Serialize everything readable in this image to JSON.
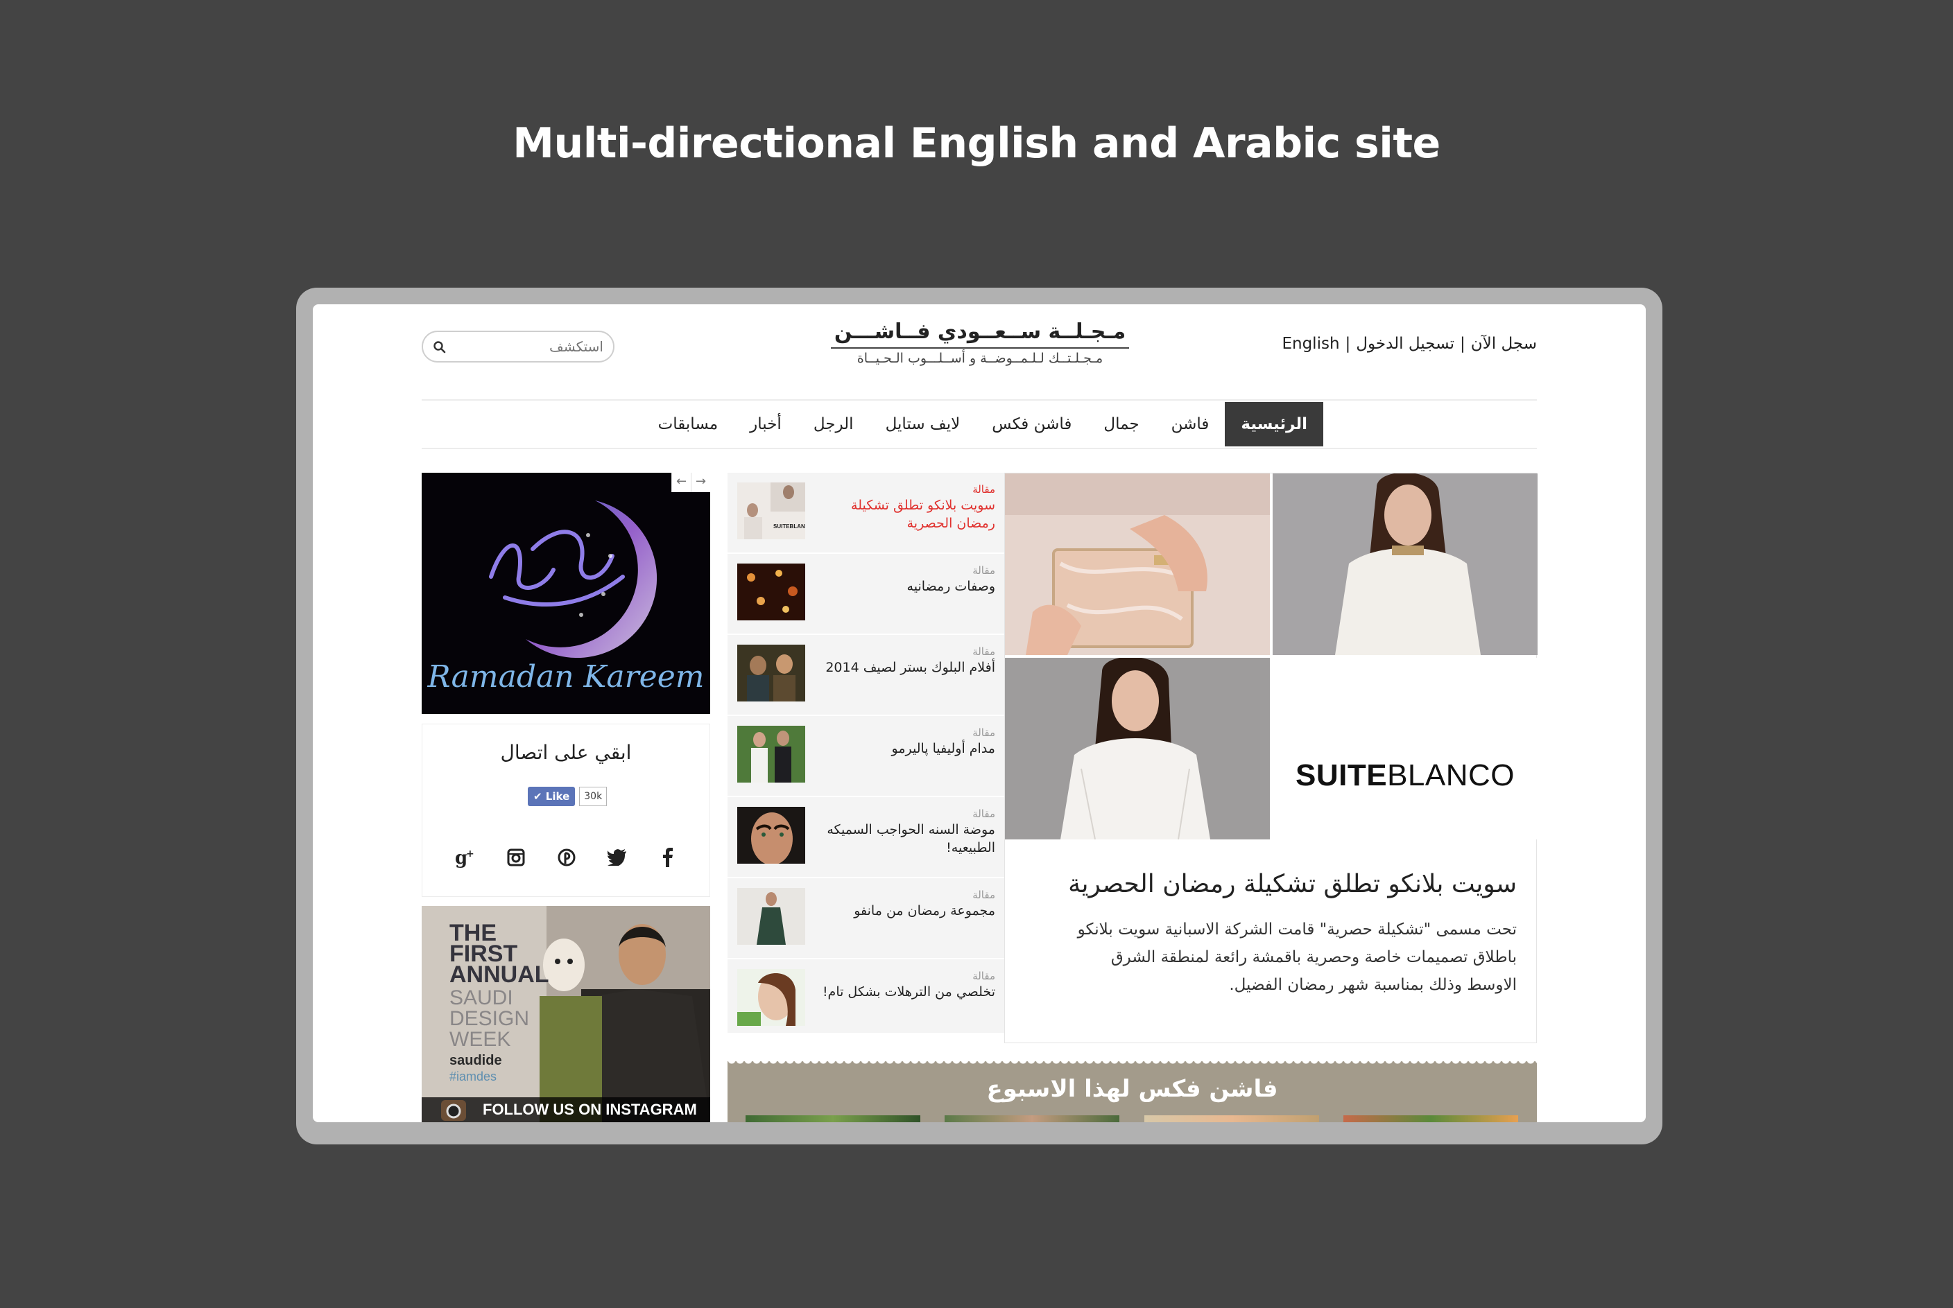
{
  "heading": "Multi-directional English and Arabic site",
  "header": {
    "signup": "سجل الآن",
    "login": "تسجيل الدخول",
    "language": "English",
    "separator": "|",
    "logo_main": "مـجـلــة ســعــودي فــاشـــن",
    "logo_sub": "مـجـلـتــك لـلـمــوضــة و أســلـــوب الـحـيــاة",
    "search_placeholder": "استكشف"
  },
  "nav": {
    "items": [
      "الرئيسية",
      "فاشن",
      "جمال",
      "فاشن فكس",
      "لايف ستايل",
      "الرجل",
      "أخبار",
      "مسابقات"
    ],
    "active": "الرئيسية"
  },
  "sidebar": {
    "ramadan_banner": "Ramadan Kareem",
    "slide_prev": "←",
    "slide_next": "→",
    "connect_title": "ابقي على اتصال",
    "like_label": "Like",
    "like_count": "30k",
    "social_icons": [
      "google-plus-icon",
      "instagram-icon",
      "pinterest-icon",
      "twitter-icon",
      "facebook-icon"
    ],
    "instagram_line1": "THE",
    "instagram_line2": "FIRST",
    "instagram_line3": "ANNUAL",
    "instagram_faded": "SAUDI DESIGN WEEK",
    "instagram_handle": "saudide",
    "instagram_hashtag": "#iamdes",
    "instagram_follow": "FOLLOW US ON INSTAGRAM"
  },
  "articles": [
    {
      "tag": "مقالة",
      "title": "سويت بلانكو تطلق تشكيلة رمضان الحصرية"
    },
    {
      "tag": "مقالة",
      "title": "وصفات رمضانيه"
    },
    {
      "tag": "مقالة",
      "title": "أفلام البلوك بستر لصيف 2014"
    },
    {
      "tag": "مقالة",
      "title": "مدام أوليفيا پاليرمو"
    },
    {
      "tag": "مقالة",
      "title": "موضة السنه الحواجب السميكه الطبيعيه!"
    },
    {
      "tag": "مقالة",
      "title": "مجموعة رمضان من مانفو"
    },
    {
      "tag": "مقالة",
      "title": "تخلصي من الترهلات بشكل تام!"
    }
  ],
  "feature": {
    "brand": "SUITEBLANCO",
    "brand_bold": "SUITE",
    "brand_light": "BLANCO",
    "title": "سويت بلانكو تطلق تشكيلة رمضان الحصرية",
    "body": "تحت مسمى \"تشكيلة حصرية\" قامت الشركة الاسبانية سويت بلانكو باطلاق تصميمات خاصة وحصرية باقمشة رائعة لمنطقة الشرق الاوسط وذلك بمناسبة شهر رمضان الفضيل."
  },
  "weekly": {
    "title": "فاشن فكس لهذا الاسبوع"
  },
  "colors": {
    "background": "#444444",
    "frame": "#b1b1b1",
    "nav_active": "#3a3a3a",
    "accent_red": "#e0322f",
    "weekly_bg": "#a39b8b",
    "like_blue": "#5b74b8"
  }
}
